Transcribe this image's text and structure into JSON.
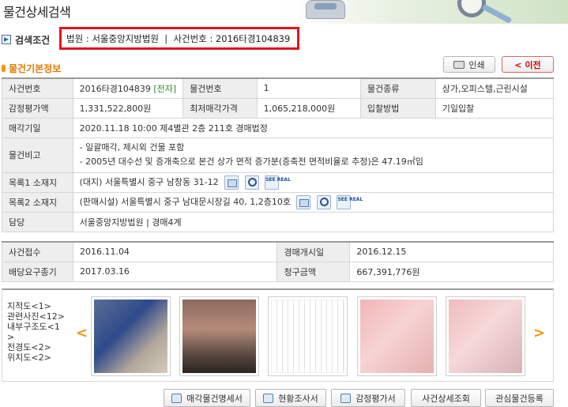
{
  "page": {
    "title": "물건상세검색"
  },
  "search": {
    "label": "검색조건",
    "criteria": "법원 : 서울중앙지방법원  |  사건번호 : 2016타경104839"
  },
  "section": {
    "title": "물건기본정보"
  },
  "toolbar": {
    "print_label": "인쇄",
    "prev_label": "< 이전"
  },
  "basic": {
    "case_no_label": "사건번호",
    "case_no_value": "2016타경104839",
    "case_no_tag": "[전자]",
    "item_no_label": "물건번호",
    "item_no_value": "1",
    "item_type_label": "물건종류",
    "item_type_value": "상가,오피스텔,근린시설",
    "appraisal_label": "감정평가액",
    "appraisal_value": "1,331,522,800원",
    "min_price_label": "최저매각가격",
    "min_price_value": "1,065,218,000원",
    "bid_method_label": "입찰방법",
    "bid_method_value": "기일입찰",
    "sale_date_label": "매각기일",
    "sale_date_value": "2020.11.18 10:00 제4별관 2층 211호 경매법정",
    "remarks_label": "물건비고",
    "remarks_line1": "- 일괄매각, 제시외 건물 포함",
    "remarks_line2": "- 2005년 대수선 및 증개축으로 본건 상가 면적 증가분(증축전 면적비율로 추정)은 47.19㎡임",
    "list1_label": "목록1 소재지",
    "list1_value": "(대지) 서울특별시 중구 남창동 31-12",
    "list2_label": "목록2 소재지",
    "list2_value": "(판매시설) 서울특별시 중구 남대문시장길 40, 1,2층10호",
    "charge_label": "담당",
    "charge_value": "서울중앙지방법원 | 경매4계"
  },
  "case": {
    "receipt_label": "사건접수",
    "receipt_value": "2016.11.04",
    "start_label": "경매개시일",
    "start_value": "2016.12.15",
    "deadline_label": "배당요구종기",
    "deadline_value": "2017.03.16",
    "claim_label": "청구금액",
    "claim_value": "667,391,776원"
  },
  "photos": {
    "labels": [
      "지적도<1>",
      "관련사진<12>",
      "내부구조도<1",
      ">",
      "전경도<2>",
      "위치도<2>"
    ],
    "prev_arrow": "<",
    "next_arrow": ">"
  },
  "bottom_buttons": {
    "sale_detail": "매각물건명세서",
    "status_report": "현황조사서",
    "appraisal_report": "감정평가서",
    "case_detail": "사건상세조회",
    "watch_register": "관심물건등록"
  },
  "see_real_text": "SEE REAL"
}
